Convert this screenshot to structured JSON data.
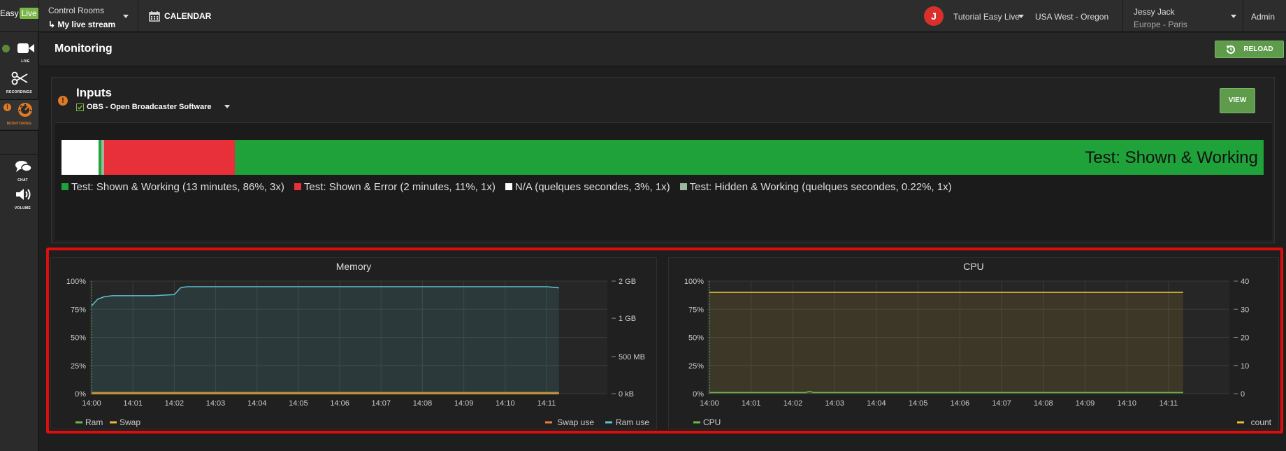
{
  "topbar": {
    "logo_text": "Easy",
    "logo_live": "Live",
    "control_rooms": "Control Rooms",
    "stream_name": "My live stream",
    "calendar_label": "CALENDAR",
    "avatar_letter": "J",
    "org_name": "Tutorial Easy Live",
    "region": "USA West - Oregon",
    "user_name": "Jessy Jack",
    "user_tz": "Europe - Paris",
    "admin_label": "Admin"
  },
  "sidebar": {
    "items": [
      {
        "label": "LIVE",
        "icon": "video-camera-icon"
      },
      {
        "label": "RECORDINGS",
        "icon": "scissors-icon"
      },
      {
        "label": "MONITORING",
        "icon": "dashboard-icon"
      },
      {
        "label": "CHAT",
        "icon": "chat-icon"
      },
      {
        "label": "VOLUME",
        "icon": "volume-icon"
      }
    ]
  },
  "header": {
    "title": "Monitoring",
    "reload_label": "RELOAD"
  },
  "inputs": {
    "title": "Inputs",
    "source": "OBS - Open Broadcaster Software",
    "view_label": "VIEW",
    "bar_label": "Test: Shown & Working",
    "segments": [
      {
        "color": "#ffffff",
        "fraction": 0.031
      },
      {
        "color": "#1fa23a",
        "fraction": 0.002
      },
      {
        "color": "#9bb79b",
        "fraction": 0.0022
      },
      {
        "color": "#e8303a",
        "fraction": 0.109
      },
      {
        "color": "#1fa23a",
        "fraction": 0.8558
      }
    ],
    "legend": [
      {
        "color": "#1fa23a",
        "text": "Test: Shown & Working (13 minutes, 86%, 3x)"
      },
      {
        "color": "#e8303a",
        "text": "Test: Shown & Error (2 minutes, 11%, 1x)"
      },
      {
        "color": "#ffffff",
        "text": "N/A (quelques secondes, 3%, 1x)"
      },
      {
        "color": "#9bb79b",
        "text": "Test: Hidden & Working (quelques secondes, 0.22%, 1x)"
      }
    ]
  },
  "chart_data": [
    {
      "type": "line",
      "title": "Memory",
      "x": [
        "14:00",
        "14:01",
        "14:02",
        "14:03",
        "14:04",
        "14:05",
        "14:06",
        "14:07",
        "14:08",
        "14:09",
        "14:10",
        "14:11"
      ],
      "y_left_ticks": [
        "0%",
        "25%",
        "50%",
        "75%",
        "100%"
      ],
      "y_right_ticks": [
        "0 kB",
        "500 MB",
        "1 GB",
        "2 GB"
      ],
      "series": [
        {
          "name": "Ram use",
          "color": "#5bc4cf",
          "axis": "right",
          "x_minutes": [
            0,
            0.15,
            0.3,
            0.5,
            1.0,
            1.5,
            2.0,
            2.15,
            2.3,
            3,
            4,
            5,
            6,
            7,
            8,
            9,
            10,
            11,
            11.3
          ],
          "values_pct": [
            78,
            84,
            86,
            87,
            87,
            87,
            88,
            94,
            95,
            95,
            95,
            95,
            95,
            95,
            95,
            95,
            95,
            95,
            94
          ]
        },
        {
          "name": "Ram",
          "color": "#6cb84a",
          "axis": "left",
          "x_minutes": [
            0,
            11.3
          ],
          "values_pct": [
            1,
            1
          ]
        },
        {
          "name": "Swap",
          "color": "#e6b93c",
          "axis": "left",
          "x_minutes": [
            0,
            11.3
          ],
          "values_pct": [
            0,
            0
          ]
        },
        {
          "name": "Swap use",
          "color": "#ea7d3c",
          "axis": "right",
          "x_minutes": [
            0,
            11.3
          ],
          "values_pct": [
            0.5,
            0.5
          ]
        }
      ],
      "legend_left": [
        {
          "name": "Ram",
          "color": "#6cb84a"
        },
        {
          "name": "Swap",
          "color": "#e6b93c"
        }
      ],
      "legend_right": [
        {
          "name": "Swap use",
          "color": "#ea7d3c"
        },
        {
          "name": "Ram use",
          "color": "#5bc4cf"
        }
      ]
    },
    {
      "type": "line",
      "title": "CPU",
      "x": [
        "14:00",
        "14:01",
        "14:02",
        "14:03",
        "14:04",
        "14:05",
        "14:06",
        "14:07",
        "14:08",
        "14:09",
        "14:10",
        "14:11"
      ],
      "y_left_ticks": [
        "0%",
        "25%",
        "50%",
        "75%",
        "100%"
      ],
      "y_right_ticks": [
        "0",
        "10",
        "20",
        "30",
        "40"
      ],
      "series": [
        {
          "name": "count",
          "color": "#e6b93c",
          "axis": "right",
          "x_minutes": [
            0,
            11.35
          ],
          "values_pct": [
            90,
            90
          ]
        },
        {
          "name": "CPU",
          "color": "#6cb84a",
          "axis": "left",
          "x_minutes": [
            0,
            2.3,
            2.4,
            2.5,
            11.35
          ],
          "values_pct": [
            1,
            1,
            2,
            1,
            1
          ]
        }
      ],
      "legend_left": [
        {
          "name": "CPU",
          "color": "#6cb84a"
        }
      ],
      "legend_right": [
        {
          "name": "count",
          "color": "#e6b93c"
        }
      ]
    }
  ]
}
